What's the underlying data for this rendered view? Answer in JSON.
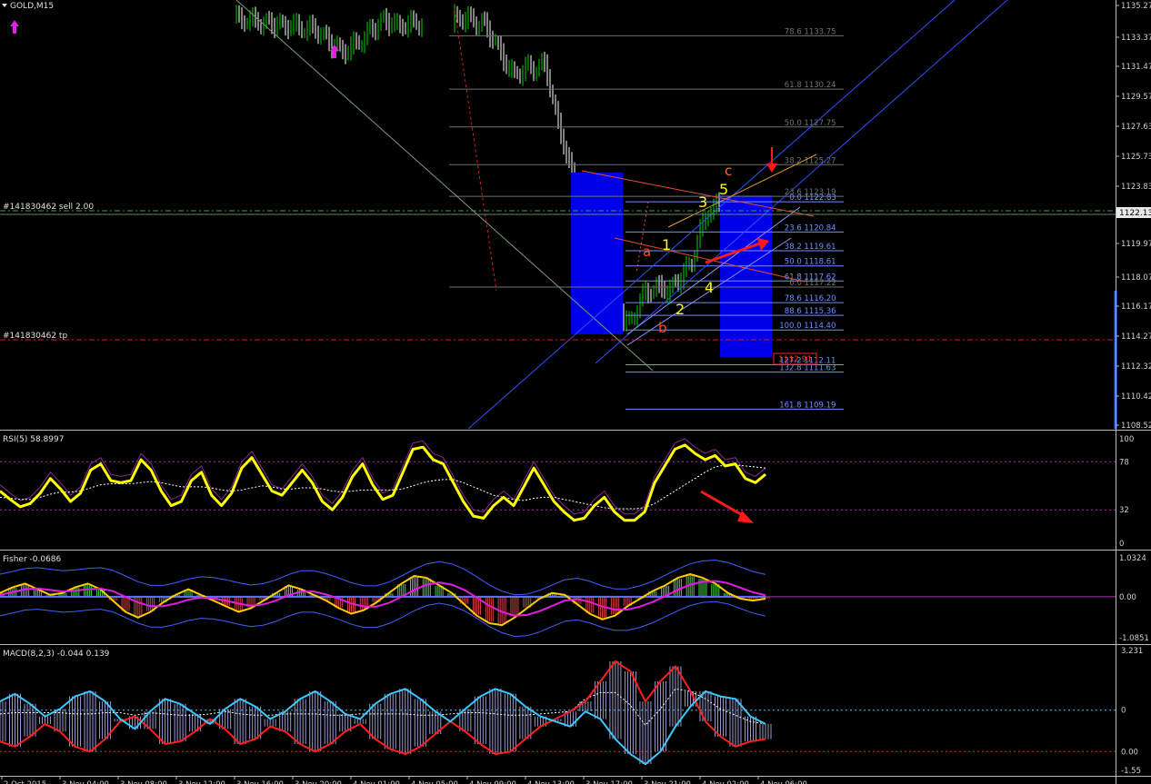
{
  "window": {
    "title": "GOLD,M15"
  },
  "trade_lines": {
    "sell_label": "#141830462 sell 2.00",
    "tp_label": "#141830462 tp"
  },
  "current_price": "1122.13",
  "stop_marker": "1112.91",
  "colors": {
    "bull": "#00d200",
    "rsi": "#ffff00",
    "fisher_main": "#e01ee0",
    "macd_main": "#3cc8ff",
    "macd_signal": "#ff2020",
    "fib": "#7090ff",
    "box": "#0000e8",
    "arrow": "#ff1a1a"
  },
  "fibs": [
    {
      "label": "78.6 1133.75",
      "price": 1133.75,
      "color": "#707070"
    },
    {
      "label": "61.8 1130.24",
      "price": 1130.24,
      "color": "#707070"
    },
    {
      "label": "50.0 1127.75",
      "price": 1127.75,
      "color": "#707070"
    },
    {
      "label": "38.2 1125.27",
      "price": 1125.27,
      "color": "#707070"
    },
    {
      "label": "23.6 1123.19",
      "price": 1123.19,
      "color": "#707070"
    },
    {
      "label": "0.0 1117.22",
      "price": 1117.22,
      "color": "#707070"
    },
    {
      "label": "0.0 1122.83",
      "price": 1122.83,
      "color": "#7090ff"
    },
    {
      "label": "23.6 1120.84",
      "price": 1120.84,
      "color": "#7090ff"
    },
    {
      "label": "38.2 1119.61",
      "price": 1119.61,
      "color": "#7090ff"
    },
    {
      "label": "50.0 1118.61",
      "price": 1118.61,
      "color": "#7090ff"
    },
    {
      "label": "61.8 1117.62",
      "price": 1117.62,
      "color": "#7090ff"
    },
    {
      "label": "78.6 1116.20",
      "price": 1116.2,
      "color": "#7090ff"
    },
    {
      "label": "88.6 1115.36",
      "price": 1115.36,
      "color": "#7090ff"
    },
    {
      "label": "100.0 1114.40",
      "price": 1114.4,
      "color": "#7090ff"
    },
    {
      "label": "127.2 1112.11",
      "price": 1112.11,
      "color": "#7090ff"
    },
    {
      "label": "132.8 1111.63",
      "price": 1111.63,
      "color": "#7090ff"
    },
    {
      "label": "161.8 1109.19",
      "price": 1109.19,
      "color": "#7090ff"
    }
  ],
  "waves": [
    "a",
    "b",
    "c",
    "1",
    "2",
    "3",
    "4",
    "5"
  ],
  "chart_data": [
    {
      "type": "candlestick",
      "title": "GOLD,M15",
      "ylim": [
        1107.9,
        1136.1
      ],
      "y_ticks": [
        "1135.27",
        "1133.37",
        "1131.47",
        "1129.57",
        "1127.63",
        "1125.73",
        "1123.83",
        "1119.97",
        "1118.07",
        "1116.17",
        "1114.27",
        "1112.32",
        "1110.42",
        "1108.52"
      ],
      "x_ticks": [
        "2 Oct 2015",
        "3 Nov 04:00",
        "3 Nov 08:00",
        "3 Nov 12:00",
        "3 Nov 16:00",
        "3 Nov 20:00",
        "4 Nov 01:00",
        "4 Nov 05:00",
        "4 Nov 09:00",
        "4 Nov 13:00",
        "3 Nov 17:00",
        "3 Nov 21:00",
        "4 Nov 02:00",
        "4 Nov 06:00"
      ],
      "close_path": [
        [
          260,
          1134.9
        ],
        [
          290,
          1134.6
        ],
        [
          320,
          1134.4
        ],
        [
          350,
          1134.1
        ],
        [
          365,
          1133.2
        ],
        [
          380,
          1132.7
        ],
        [
          400,
          1133.6
        ],
        [
          420,
          1134.8
        ],
        [
          440,
          1134.4
        ],
        [
          460,
          1134.6
        ],
        [
          500,
          1135.0
        ],
        [
          530,
          1134.6
        ],
        [
          545,
          1133.4
        ],
        [
          555,
          1132.0
        ],
        [
          565,
          1131.2
        ],
        [
          580,
          1131.6
        ],
        [
          600,
          1131.8
        ],
        [
          608,
          1129.6
        ],
        [
          616,
          1127.4
        ],
        [
          624,
          1125.8
        ],
        [
          632,
          1124.2
        ],
        [
          640,
          1123.3
        ],
        [
          650,
          1123.7
        ],
        [
          660,
          1123.0
        ],
        [
          670,
          1120.6
        ],
        [
          678,
          1117.2
        ],
        [
          686,
          1115.1
        ],
        [
          692,
          1114.8
        ],
        [
          700,
          1115.8
        ],
        [
          710,
          1116.8
        ],
        [
          720,
          1117.2
        ],
        [
          735,
          1117.0
        ],
        [
          748,
          1117.8
        ],
        [
          760,
          1118.8
        ],
        [
          770,
          1120.8
        ],
        [
          780,
          1122.3
        ],
        [
          790,
          1122.6
        ],
        [
          800,
          1122.3
        ],
        [
          815,
          1122.4
        ],
        [
          830,
          1122.0
        ],
        [
          842,
          1122.3
        ]
      ]
    },
    {
      "type": "line",
      "title": "RSI(5) 58.8997",
      "ylim": [
        0,
        100
      ],
      "y_ticks": [
        "100",
        "78",
        "32",
        "0"
      ],
      "levels": [
        78,
        32
      ],
      "values_rsi": [
        50,
        42,
        35,
        38,
        48,
        62,
        52,
        40,
        48,
        70,
        76,
        60,
        58,
        60,
        80,
        70,
        50,
        36,
        40,
        60,
        68,
        46,
        36,
        48,
        72,
        82,
        66,
        50,
        46,
        58,
        70,
        58,
        40,
        32,
        44,
        64,
        76,
        56,
        42,
        46,
        68,
        90,
        92,
        80,
        76,
        58,
        40,
        26,
        24,
        36,
        44,
        36,
        54,
        72,
        56,
        40,
        30,
        22,
        24,
        36,
        44,
        30,
        22,
        22,
        30,
        58,
        74,
        90,
        94,
        86,
        80,
        84,
        74,
        76,
        62,
        58,
        66
      ],
      "values_signal": [
        44,
        43,
        42,
        42,
        44,
        47,
        49,
        49,
        50,
        53,
        56,
        57,
        57,
        57,
        58,
        59,
        58,
        56,
        54,
        54,
        54,
        53,
        51,
        50,
        51,
        53,
        55,
        54,
        52,
        52,
        53,
        53,
        52,
        50,
        49,
        50,
        51,
        51,
        51,
        51,
        52,
        55,
        58,
        60,
        61,
        61,
        58,
        54,
        50,
        46,
        44,
        42,
        41,
        43,
        44,
        44,
        42,
        40,
        38,
        36,
        34,
        33,
        33,
        33,
        34,
        38,
        44,
        50,
        56,
        62,
        68,
        73,
        75,
        75,
        74,
        73,
        72
      ]
    },
    {
      "type": "line",
      "title": "Fisher -0.0686",
      "ylim": [
        -1.0851,
        1.0324
      ],
      "y_ticks": [
        "1.0324",
        "0.00",
        "-1.0851"
      ],
      "values_fisher": [
        0.1,
        0.25,
        0.35,
        0.2,
        0.05,
        0.1,
        0.25,
        0.35,
        0.2,
        -0.1,
        -0.4,
        -0.55,
        -0.4,
        -0.15,
        0.05,
        0.2,
        0.05,
        -0.1,
        -0.25,
        -0.4,
        -0.3,
        -0.1,
        0.1,
        0.3,
        0.2,
        0.05,
        -0.1,
        -0.3,
        -0.45,
        -0.35,
        -0.15,
        0.1,
        0.35,
        0.55,
        0.5,
        0.3,
        0.1,
        -0.2,
        -0.5,
        -0.7,
        -0.75,
        -0.55,
        -0.3,
        -0.05,
        0.1,
        0.05,
        -0.2,
        -0.45,
        -0.6,
        -0.5,
        -0.25,
        -0.05,
        0.15,
        0.3,
        0.5,
        0.6,
        0.5,
        0.35,
        0.1,
        -0.05,
        -0.1,
        -0.05
      ],
      "values_signal": [
        0.05,
        0.12,
        0.2,
        0.22,
        0.18,
        0.14,
        0.16,
        0.2,
        0.22,
        0.15,
        0.0,
        -0.15,
        -0.25,
        -0.25,
        -0.18,
        -0.08,
        -0.02,
        -0.04,
        -0.1,
        -0.18,
        -0.24,
        -0.2,
        -0.1,
        0.04,
        0.14,
        0.14,
        0.06,
        -0.05,
        -0.18,
        -0.26,
        -0.26,
        -0.16,
        0.0,
        0.18,
        0.32,
        0.38,
        0.32,
        0.18,
        -0.02,
        -0.24,
        -0.4,
        -0.5,
        -0.48,
        -0.38,
        -0.24,
        -0.1,
        -0.06,
        -0.14,
        -0.26,
        -0.34,
        -0.34,
        -0.26,
        -0.14,
        0.02,
        0.18,
        0.32,
        0.4,
        0.42,
        0.36,
        0.24,
        0.12,
        0.04
      ]
    },
    {
      "type": "line",
      "title": "MACD(8,2,3) -0.044 0.139",
      "ylim": [
        -1.55,
        3.231
      ],
      "y_ticks": [
        "3.231",
        "0",
        "0.00",
        "-1.55"
      ],
      "values_macd": [
        1.2,
        1.5,
        1.1,
        0.6,
        0.9,
        1.4,
        1.6,
        1.2,
        0.5,
        0.1,
        0.8,
        1.3,
        1.1,
        0.7,
        0.3,
        0.9,
        1.3,
        1.0,
        0.5,
        0.8,
        1.3,
        1.6,
        1.2,
        0.7,
        0.5,
        1.1,
        1.5,
        1.7,
        1.3,
        0.8,
        0.4,
        0.9,
        1.4,
        1.7,
        1.5,
        1.0,
        0.6,
        0.4,
        0.2,
        0.8,
        0.5,
        -0.3,
        -0.9,
        -1.3,
        -0.8,
        0.2,
        1.0,
        1.6,
        1.4,
        1.3,
        0.6,
        0.3
      ],
      "values_signal": [
        -0.4,
        -0.6,
        -0.2,
        0.3,
        0.0,
        -0.6,
        -0.8,
        -0.3,
        0.4,
        0.6,
        0.1,
        -0.5,
        -0.4,
        0.0,
        0.5,
        0.1,
        -0.5,
        -0.3,
        0.2,
        0.0,
        -0.5,
        -0.8,
        -0.5,
        0.0,
        0.3,
        -0.3,
        -0.7,
        -0.9,
        -0.6,
        -0.1,
        0.4,
        0.0,
        -0.5,
        -0.9,
        -0.8,
        -0.3,
        0.2,
        0.5,
        0.8,
        1.2,
        2.0,
        2.8,
        2.4,
        1.2,
        2.0,
        2.6,
        1.6,
        0.4,
        -0.2,
        -0.6,
        -0.4,
        -0.3
      ]
    }
  ]
}
